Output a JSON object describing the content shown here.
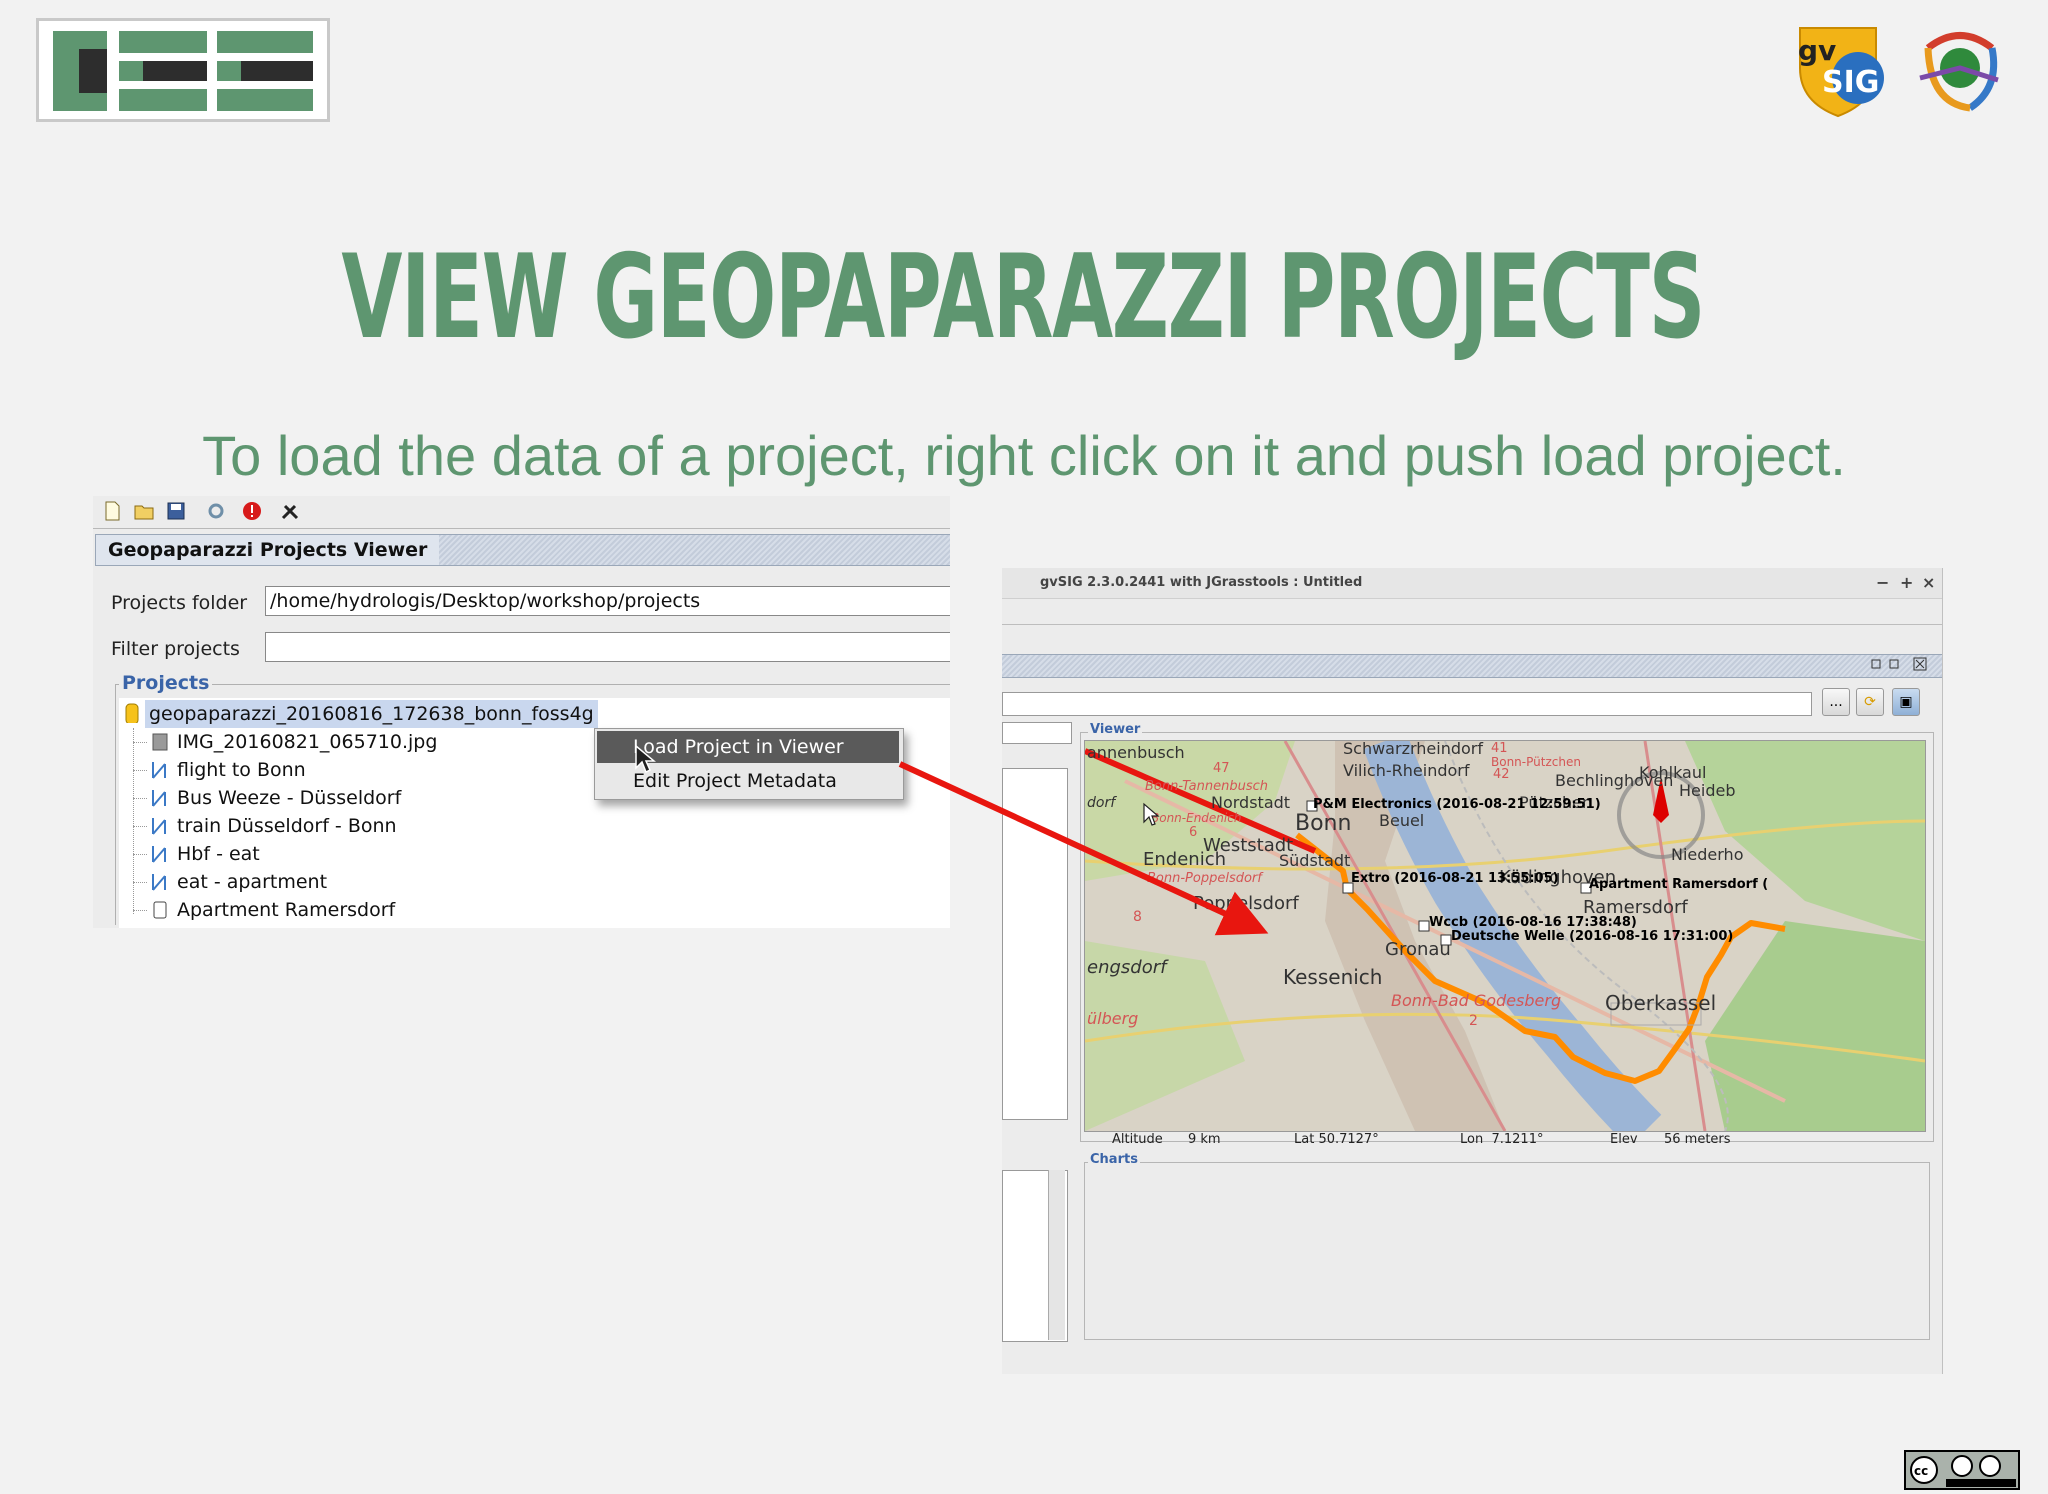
{
  "slide": {
    "title": "VIEW GEOPAPARAZZI PROJECTS",
    "subtitle": "To load the data of a project, right click on it and push load project.",
    "accent_color": "#5e9670",
    "logos": {
      "left": "hee-logo",
      "right": [
        "gvsig-logo",
        "jgrasstools-logo"
      ],
      "license": "cc-by-sa-badge"
    }
  },
  "projects_viewer": {
    "panel_title": "Geopaparazzi Projects Viewer",
    "toolbar_icons": [
      "new-file-icon",
      "open-folder-icon",
      "save-icon",
      "refresh-icon",
      "error-icon",
      "tools-icon"
    ],
    "folder_label": "Projects folder",
    "folder_value": "/home/hydrologis/Desktop/workshop/projects",
    "filter_label": "Filter projects",
    "filter_value": "",
    "projects_label": "Projects",
    "project_root": "geopaparazzi_20160816_172638_bonn_foss4g",
    "items": [
      {
        "label": "IMG_20160821_065710.jpg",
        "icon": "image-icon"
      },
      {
        "label": "flight to Bonn",
        "icon": "track-icon"
      },
      {
        "label": "Bus Weeze - Düsseldorf",
        "icon": "track-icon"
      },
      {
        "label": "train Düsseldorf - Bonn",
        "icon": "track-icon"
      },
      {
        "label": "Hbf - eat",
        "icon": "track-icon"
      },
      {
        "label": "eat - apartment",
        "icon": "track-icon"
      },
      {
        "label": "Apartment Ramersdorf",
        "icon": "note-icon"
      }
    ],
    "context_menu": {
      "load": "Load Project in Viewer",
      "edit": "Edit Project Metadata"
    }
  },
  "gvsig_window": {
    "title": "gvSIG 2.3.0.2441 with JGrasstools : Untitled",
    "window_controls": [
      "−",
      "+",
      "×"
    ],
    "viewer_label": "Viewer",
    "charts_label": "Charts",
    "browse_button": "...",
    "map_labels": {
      "annenbusch": "annenbusch",
      "schwarzrheindorf": "Schwarzrheindorf",
      "vilich": "Vilich-Rheindorf",
      "bonn_putzchen": "Bonn-Pützchen",
      "bechlinghoven": "Bechlinghoven",
      "kohlkaul": "Kohlkaul",
      "tannenbusch": "Bonn-Tannenbusch",
      "nordstadt": "Nordstadt",
      "dorf": "dorf",
      "putzchen": "Pützchen",
      "heideb": "Heideb",
      "bonn_endenich": "Bonn-Endenich",
      "bonn": "Bonn",
      "beuel": "Beuel",
      "weststadt": "Weststadt",
      "sudstadt": "Südstadt",
      "endenich": "Endenich",
      "niederho": "Niederho",
      "kudinghoven": "Küdinghoven",
      "bonn_poppelsdorf": "Bonn-Poppelsdorf",
      "poppelsdorf": "Poppelsdorf",
      "ramersdorf": "Ramersdorf",
      "gronau": "Gronau",
      "engsdorf": "engsdorf",
      "kessenich": "Kessenich",
      "bad_godesberg": "Bonn-Bad Godesberg",
      "oberkassel": "Oberkassel",
      "alberg": "ülberg",
      "r41": "41",
      "r42": "42",
      "r47": "47",
      "r6": "6",
      "r8": "8",
      "r2": "2"
    },
    "pois": [
      "P&M Electronics (2016-08-21 12:59:51)",
      "Extro (2016-08-21 13:55:05)",
      "Apartment Ramersdorf (",
      "Wccb (2016-08-16 17:38:48)",
      "Deutsche Welle (2016-08-16 17:31:00)"
    ],
    "status": {
      "altitude_label": "Altitude",
      "altitude_value": "9 km",
      "lat": "Lat 50.7127°",
      "lon": "Lon  7.1211°",
      "elev_label": "Elev",
      "elev_value": "56 meters"
    }
  },
  "colors": {
    "track": "#ff8c00",
    "arrow": "#e8160f",
    "selection": "#c9d7ee"
  }
}
